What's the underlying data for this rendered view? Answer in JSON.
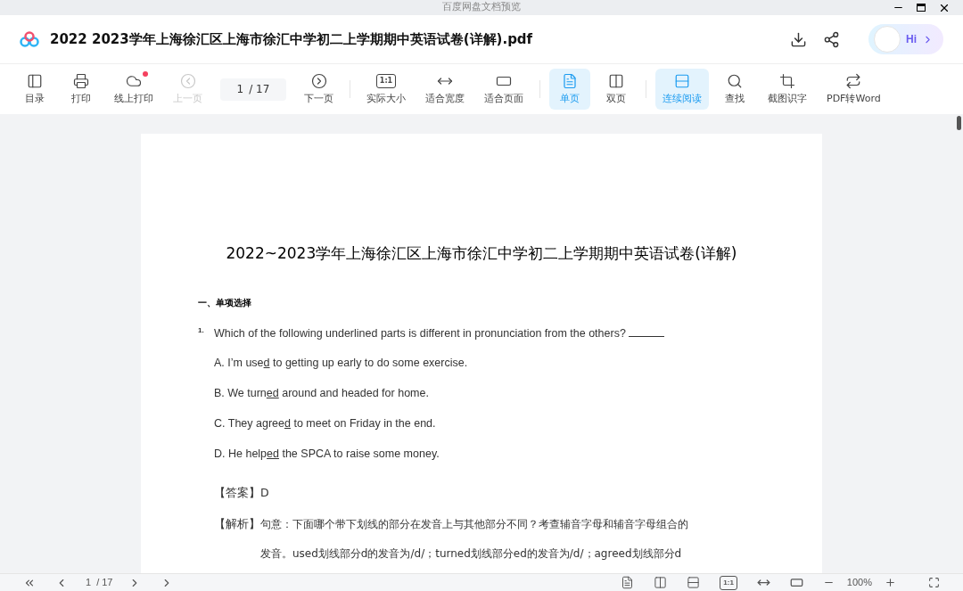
{
  "window": {
    "title": "百度网盘文档预览"
  },
  "header": {
    "file_name": "2022 2023学年上海徐汇区上海市徐汇中学初二上学期期中英语试卷(详解).pdf",
    "assistant_label": "Hi"
  },
  "toolbar": [
    {
      "kind": "button",
      "label": "目录",
      "selected": false,
      "disabled": false,
      "badge": false
    },
    {
      "kind": "button",
      "label": "打印",
      "selected": false,
      "disabled": false,
      "badge": false
    },
    {
      "kind": "button",
      "label": "线上打印",
      "selected": false,
      "disabled": false,
      "badge": true
    },
    {
      "kind": "button",
      "label": "上一页",
      "selected": false,
      "disabled": true,
      "badge": false
    },
    {
      "kind": "page",
      "current": "1",
      "total": "/ 17"
    },
    {
      "kind": "button",
      "label": "下一页",
      "selected": false,
      "disabled": false,
      "badge": false
    },
    {
      "kind": "separator"
    },
    {
      "kind": "button",
      "icon_text": "1:1",
      "label": "实际大小",
      "selected": false,
      "disabled": false,
      "badge": false
    },
    {
      "kind": "button",
      "label": "适合宽度",
      "selected": false,
      "disabled": false,
      "badge": false
    },
    {
      "kind": "button",
      "label": "适合页面",
      "selected": false,
      "disabled": false,
      "badge": false
    },
    {
      "kind": "separator"
    },
    {
      "kind": "button",
      "label": "单页",
      "selected": true,
      "disabled": false,
      "badge": false
    },
    {
      "kind": "button",
      "label": "双页",
      "selected": false,
      "disabled": false,
      "badge": false
    },
    {
      "kind": "separator"
    },
    {
      "kind": "button",
      "label": "连续阅读",
      "selected": true,
      "disabled": false,
      "badge": false
    },
    {
      "kind": "button",
      "label": "查找",
      "selected": false,
      "disabled": false,
      "badge": false
    },
    {
      "kind": "button",
      "label": "截图识字",
      "selected": false,
      "disabled": false,
      "badge": false
    },
    {
      "kind": "button",
      "label": "PDF转Word",
      "selected": false,
      "disabled": false,
      "badge": false
    }
  ],
  "document": {
    "title": "2022~2023学年上海徐汇区上海市徐汇中学初二上学期期中英语试卷(详解)",
    "section": "一、单项选择",
    "question": {
      "number": "1.",
      "text": "Which of the following underlined parts is different in pronunciation from the others?",
      "options": [
        {
          "before": "A. I’m use",
          "underlined": "d",
          "after": " to getting up early to do some exercise."
        },
        {
          "before": "B. We turn",
          "underlined": "ed",
          "after": " around and headed for home."
        },
        {
          "before": "C. They agree",
          "underlined": "d",
          "after": " to meet on Friday in the end."
        },
        {
          "before": "D. He help",
          "underlined": "ed",
          "after": " the SPCA to raise some money."
        }
      ],
      "answer_label": "【答案】",
      "answer": "D",
      "analysis_label": "【解析】",
      "analysis_line1": "句意：下面哪个带下划线的部分在发音上与其他部分不同？考查辅音字母和辅音字母组合的",
      "analysis_line2": "发音。used划线部分d的发音为/d/；turned划线部分ed的发音为/d/；agreed划线部分d"
    }
  },
  "bottom_bar": {
    "page_current": "1",
    "page_total": "/ 17",
    "actual_size_text": "1:1",
    "zoom": "100%",
    "view_modes": [
      {
        "selected": false
      },
      {
        "selected": false
      },
      {
        "selected": false
      }
    ]
  }
}
